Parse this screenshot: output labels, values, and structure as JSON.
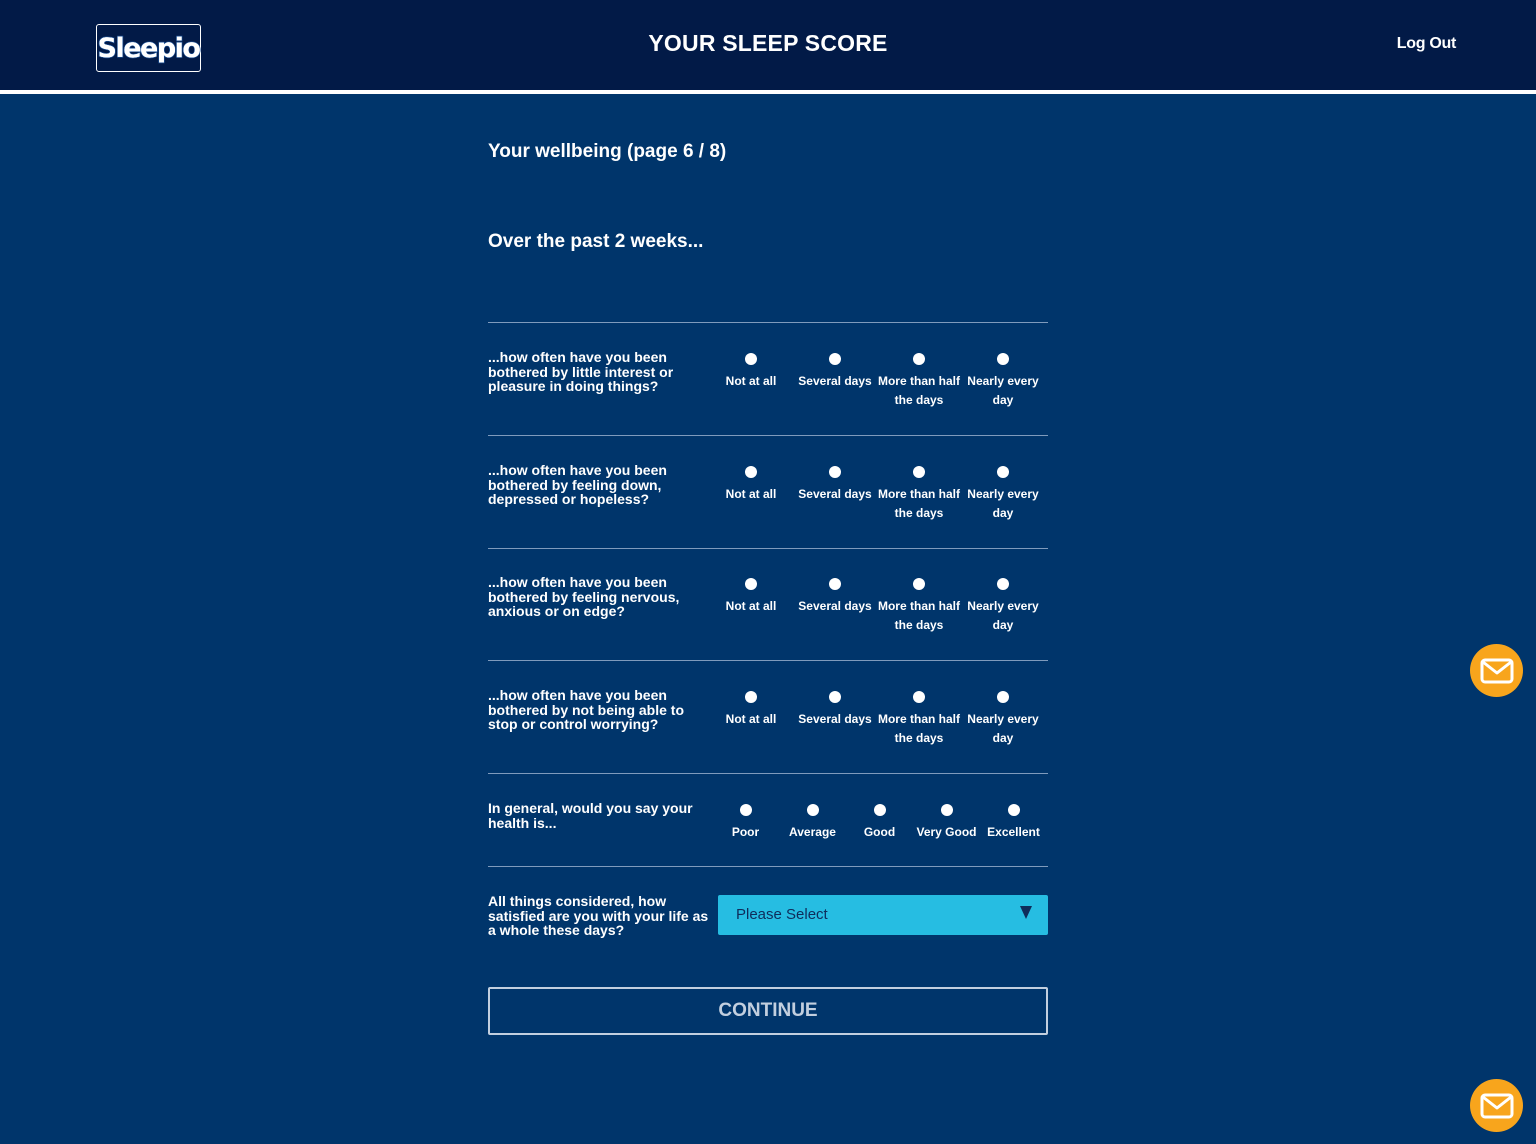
{
  "header": {
    "logo_text": "Sleepio",
    "title": "YOUR SLEEP SCORE",
    "logout_label": "Log Out"
  },
  "form": {
    "section_title": "Your wellbeing (page 6 / 8)",
    "lead": "Over the past 2 weeks...",
    "frequency_options": [
      "Not at all",
      "Several days",
      "More than half\nthe days",
      "Nearly every\nday"
    ],
    "health_options": [
      "Poor",
      "Average",
      "Good",
      "Very Good",
      "Excellent"
    ],
    "questions": [
      "...how often have you been bothered by little interest or pleasure in doing things?",
      "...how often have you been bothered by feeling down, depressed or hopeless?",
      "...how often have you been bothered by feeling nervous, anxious or on edge?",
      "...how often have you been bothered by not being able to stop or control worrying?"
    ],
    "health_question": "In general, would you say your health is...",
    "life_question": "All things considered, how satisfied are you with your life as a whole these days?",
    "life_select_value": "Please Select",
    "continue_label": "CONTINUE"
  },
  "colors": {
    "page_background": "#00356b",
    "header_background": "#021a47",
    "select_background": "#26bde2",
    "fab_color": "#f8a51c"
  },
  "icons": {
    "support_button": "mail-icon"
  }
}
